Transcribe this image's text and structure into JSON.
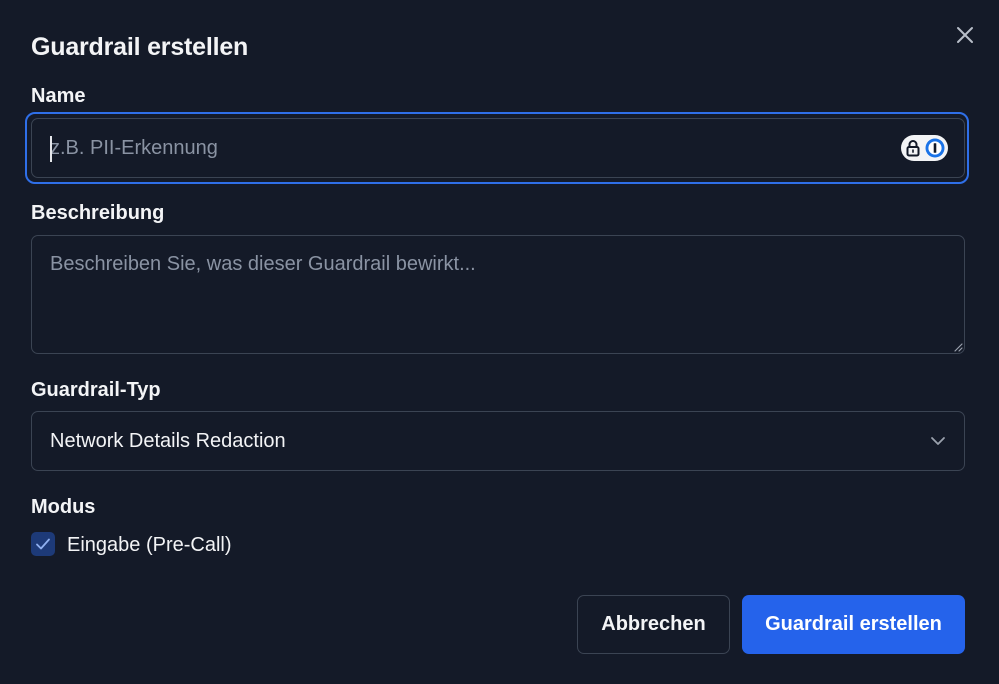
{
  "dialog": {
    "title": "Guardrail erstellen",
    "close_icon": "close-icon"
  },
  "name_field": {
    "label": "Name",
    "placeholder": "z.B. PII-Erkennung",
    "value": "",
    "password_manager_icons": [
      "lock-icon",
      "password-manager-icon"
    ]
  },
  "description_field": {
    "label": "Beschreibung",
    "placeholder": "Beschreiben Sie, was dieser Guardrail bewirkt...",
    "value": ""
  },
  "type_field": {
    "label": "Guardrail-Typ",
    "selected": "Network Details Redaction",
    "dropdown_icon": "chevron-down-icon"
  },
  "mode_field": {
    "label": "Modus",
    "options": [
      {
        "label": "Eingabe (Pre-Call)",
        "checked": true
      }
    ]
  },
  "actions": {
    "cancel_label": "Abbrechen",
    "submit_label": "Guardrail erstellen"
  },
  "colors": {
    "background": "#141a28",
    "border": "#3b4453",
    "focus_ring": "#2f6fe8",
    "primary": "#2563eb",
    "checkbox_fill": "#1d3a78",
    "placeholder": "#8a93a3"
  }
}
